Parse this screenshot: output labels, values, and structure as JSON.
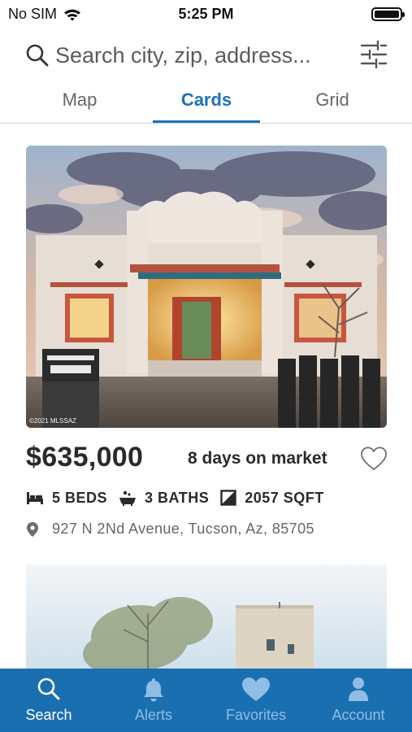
{
  "status_bar": {
    "carrier": "No SIM",
    "time": "5:25 PM"
  },
  "search": {
    "placeholder": "Search city, zip, address..."
  },
  "tabs": [
    {
      "label": "Map",
      "active": false
    },
    {
      "label": "Cards",
      "active": true
    },
    {
      "label": "Grid",
      "active": false
    }
  ],
  "listing": {
    "price": "$635,000",
    "days_on_market": "8 days on market",
    "beds": "5 BEDS",
    "baths": "3 BATHS",
    "sqft": "2057 SQFT",
    "address": "927 N 2Nd Avenue, Tucson, Az, 85705",
    "photo_watermark": "©2021 MLSSAZ",
    "favorited": false
  },
  "bottom_nav": [
    {
      "label": "Search",
      "icon": "search-icon",
      "active": true
    },
    {
      "label": "Alerts",
      "icon": "bell-icon",
      "active": false
    },
    {
      "label": "Favorites",
      "icon": "heart-icon",
      "active": false
    },
    {
      "label": "Account",
      "icon": "person-icon",
      "active": false
    }
  ],
  "colors": {
    "accent": "#1f72b8",
    "nav_background": "#1a6fb0",
    "nav_inactive": "#8fbde3"
  }
}
